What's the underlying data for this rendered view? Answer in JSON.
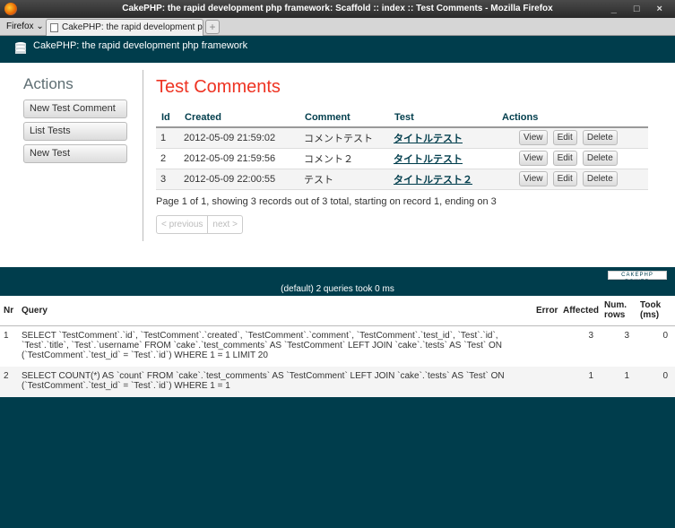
{
  "window": {
    "title": "CakePHP: the rapid development php framework: Scaffold :: index :: Test Comments - Mozilla Firefox",
    "controls": "_ □ ×"
  },
  "browser": {
    "menu_label": "Firefox",
    "tab_title": "CakePHP: the rapid development p...",
    "new_tab_label": "+"
  },
  "header": {
    "brand": "CakePHP: the rapid development php framework"
  },
  "sidebar": {
    "title": "Actions",
    "items": [
      {
        "label": "New Test Comment"
      },
      {
        "label": "List Tests"
      },
      {
        "label": "New Test"
      }
    ]
  },
  "main": {
    "title": "Test Comments",
    "columns": [
      "Id",
      "Created",
      "Comment",
      "Test",
      "Actions"
    ],
    "rows": [
      {
        "id": "1",
        "created": "2012-05-09 21:59:02",
        "comment": "コメントテスト",
        "test": "タイトルテスト"
      },
      {
        "id": "2",
        "created": "2012-05-09 21:59:56",
        "comment": "コメント２",
        "test": "タイトルテスト"
      },
      {
        "id": "3",
        "created": "2012-05-09 22:00:55",
        "comment": "テスト",
        "test": "タイトルテスト２"
      }
    ],
    "actions": {
      "view": "View",
      "edit": "Edit",
      "delete": "Delete"
    },
    "paging_info": "Page 1 of 1, showing 3 records out of 3 total, starting on record 1, ending on 3",
    "prev_label": "< previous",
    "next_label": "next >"
  },
  "footer": {
    "power_badge": "CAKEPHP POWER",
    "query_summary": "(default) 2 queries took 0 ms"
  },
  "sql_log": {
    "columns": {
      "nr": "Nr",
      "query": "Query",
      "error": "Error",
      "affected": "Affected",
      "num_rows": "Num. rows",
      "took": "Took (ms)"
    },
    "rows": [
      {
        "nr": "1",
        "query": "SELECT `TestComment`.`id`, `TestComment`.`created`, `TestComment`.`comment`, `TestComment`.`test_id`, `Test`.`id`, `Test`.`title`, `Test`.`username` FROM `cake`.`test_comments` AS `TestComment` LEFT JOIN `cake`.`tests` AS `Test` ON (`TestComment`.`test_id` = `Test`.`id`) WHERE 1 = 1 LIMIT 20",
        "error": "",
        "affected": "3",
        "num_rows": "3",
        "took": "0"
      },
      {
        "nr": "2",
        "query": "SELECT COUNT(*) AS `count` FROM `cake`.`test_comments` AS `TestComment` LEFT JOIN `cake`.`tests` AS `Test` ON (`TestComment`.`test_id` = `Test`.`id`) WHERE 1 = 1",
        "error": "",
        "affected": "1",
        "num_rows": "1",
        "took": "0"
      }
    ]
  }
}
